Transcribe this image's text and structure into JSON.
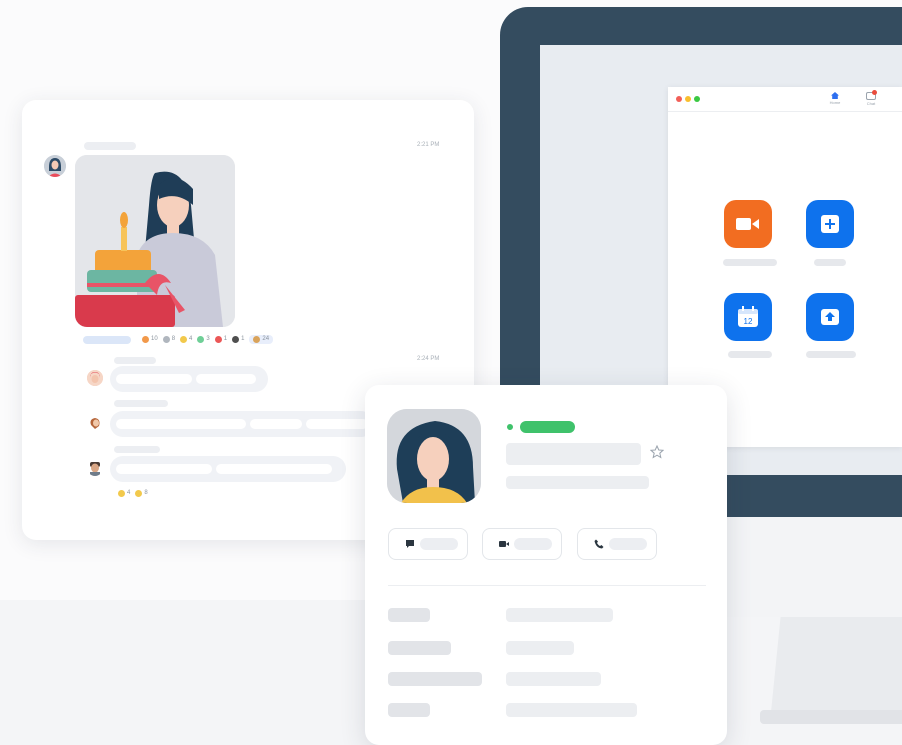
{
  "chat": {
    "message1": {
      "time": "2:21 PM"
    },
    "message2": {
      "time": "2:24 PM"
    },
    "reactions": [
      {
        "icon": "fire-emoji-icon",
        "count": "10",
        "color": "#f2994a"
      },
      {
        "icon": "calendar-emoji-icon",
        "count": "8",
        "color": "#b0b6be"
      },
      {
        "icon": "clap-emoji-icon",
        "count": "4",
        "color": "#f2c94c"
      },
      {
        "icon": "plant-emoji-icon",
        "count": "3",
        "color": "#6fcf97"
      },
      {
        "icon": "heart-emoji-icon",
        "count": "1",
        "color": "#eb5757"
      },
      {
        "icon": "camera-emoji-icon",
        "count": "1",
        "color": "#4f4f4f"
      },
      {
        "icon": "party-emoji-icon",
        "count": "24",
        "color": "#d9a35b"
      }
    ],
    "bottom_reactions": [
      {
        "icon": "smile-emoji-icon",
        "count": "4",
        "color": "#f2c94c"
      },
      {
        "icon": "cool-emoji-icon",
        "count": "8",
        "color": "#f2c94c"
      }
    ]
  },
  "app": {
    "nav": {
      "home_label": "Home",
      "chat_label": "Chat"
    },
    "tiles": [
      {
        "name": "new-meeting-tile",
        "icon": "video-camera-icon",
        "color": "#f26d21"
      },
      {
        "name": "join-tile",
        "icon": "plus-icon",
        "color": "#0e72ed"
      },
      {
        "name": "schedule-tile",
        "icon": "calendar-icon",
        "color": "#0e72ed",
        "day": "12"
      },
      {
        "name": "share-screen-tile",
        "icon": "upload-arrow-icon",
        "color": "#0e72ed"
      }
    ]
  },
  "colors": {
    "accent_blue": "#0e72ed",
    "accent_orange": "#f26d21",
    "status_green": "#3fc26b",
    "monitor_frame": "#344c5f"
  }
}
